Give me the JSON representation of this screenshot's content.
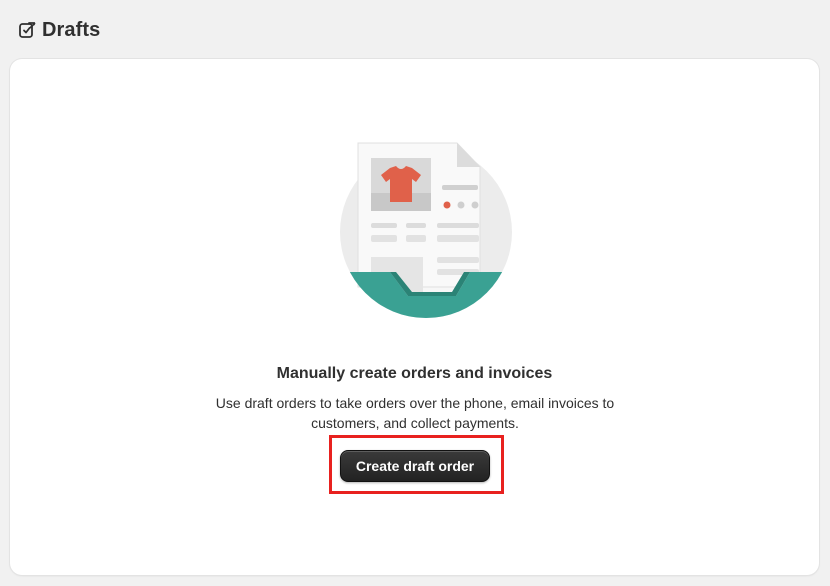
{
  "header": {
    "title": "Drafts",
    "icon": "draft-order-icon"
  },
  "empty_state": {
    "illustration": "draft-invoice-illustration",
    "heading": "Manually create orders and invoices",
    "description": "Use draft orders to take orders over the phone, email invoices to customers, and collect payments.",
    "action_label": "Create draft order"
  },
  "colors": {
    "background": "#f1f1f1",
    "card": "#ffffff",
    "primary_button": "#303030",
    "illustration_teal": "#3aa193",
    "illustration_shirt": "#e0614a",
    "highlight": "#e8211f"
  }
}
